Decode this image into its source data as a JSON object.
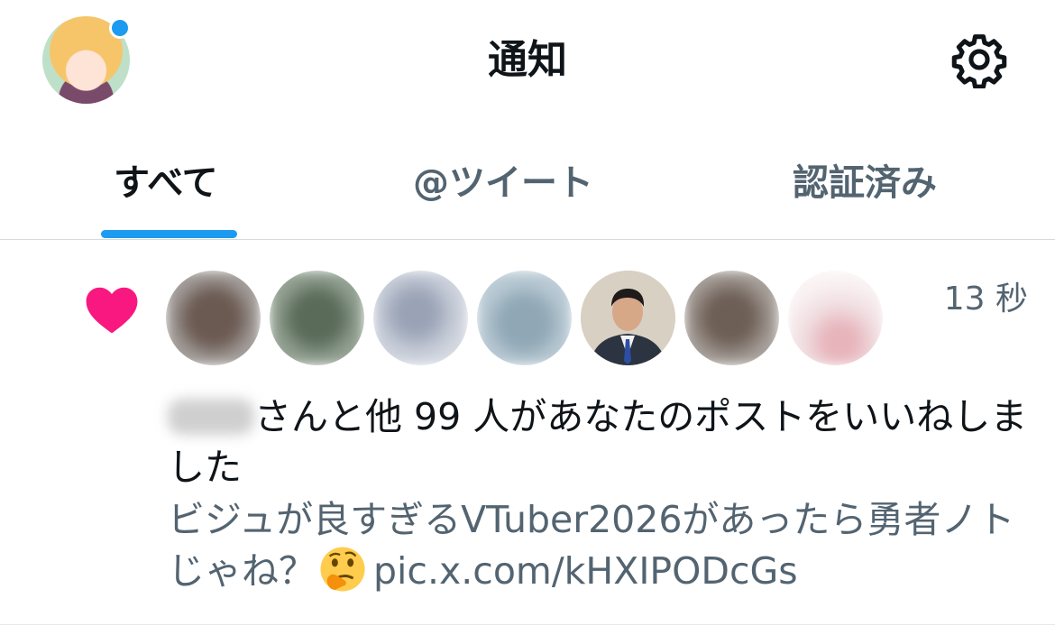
{
  "header": {
    "title": "通知",
    "profile_icon": "user-avatar",
    "settings_icon": "gear-icon"
  },
  "tabs": [
    {
      "label": "すべて",
      "active": true
    },
    {
      "label": "@ツイート",
      "active": false
    },
    {
      "label": "認証済み",
      "active": false
    }
  ],
  "notification": {
    "type_icon": "heart-icon",
    "timestamp": "13 秒",
    "text_suffix": "さんと他 99 人があなたのポストをいいねしました",
    "tweet_text_main": "ビジュが良すぎるVTuber2026があったら勇者ノトじゃね？",
    "tweet_emoji": "thinking-face-icon",
    "tweet_link": "pic.x.com/kHXIPODcGs"
  },
  "colors": {
    "accent": "#1d9bf0",
    "heart": "#f91880",
    "secondary_text": "#536471"
  }
}
